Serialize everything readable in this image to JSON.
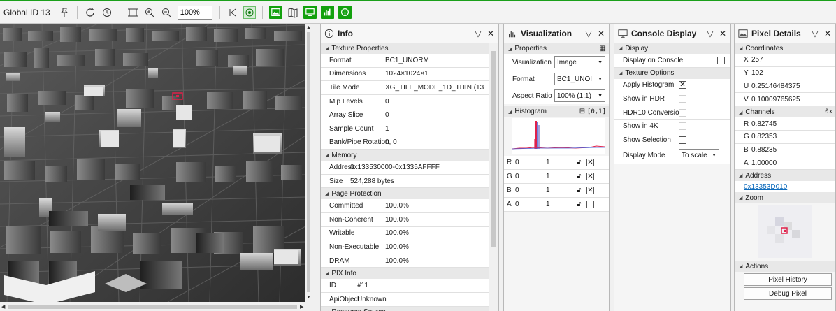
{
  "toolbar": {
    "title": "Global ID 13",
    "zoom_value": "100%",
    "icons": [
      "pin-icon",
      "refresh-icon",
      "history-icon",
      "fit-icon",
      "zoom-in-icon",
      "zoom-out-icon",
      "step-back-icon",
      "target-icon",
      "image-view-icon",
      "map-icon",
      "monitor-icon",
      "histogram-icon",
      "info-icon"
    ],
    "accent": "#13a10e"
  },
  "info": {
    "title": "Info",
    "sections": [
      {
        "title": "Texture Properties",
        "rows": [
          [
            "Format",
            "BC1_UNORM"
          ],
          [
            "Dimensions",
            "1024×1024×1"
          ],
          [
            "Tile Mode",
            "XG_TILE_MODE_1D_THIN (13"
          ],
          [
            "Mip Levels",
            "0"
          ],
          [
            "Array Slice",
            "0"
          ],
          [
            "Sample Count",
            "1"
          ],
          [
            "Bank/Pipe Rotation",
            "0, 0"
          ]
        ]
      },
      {
        "title": "Memory",
        "rows": [
          [
            "Address",
            "0x133530000-0x1335AFFFF"
          ],
          [
            "Size",
            "524,288 bytes"
          ]
        ]
      },
      {
        "title": "Page Protection",
        "rows": [
          [
            "Committed",
            "100.0%"
          ],
          [
            "Non-Coherent",
            "100.0%"
          ],
          [
            "Writable",
            "100.0%"
          ],
          [
            "Non-Executable",
            "100.0%"
          ],
          [
            "DRAM",
            "100.0%"
          ]
        ]
      },
      {
        "title": "PIX Info",
        "rows": [
          [
            "ID",
            "#11"
          ],
          [
            "ApiObject",
            "Unknown"
          ]
        ]
      },
      {
        "title": "Resource Source",
        "rows": []
      }
    ]
  },
  "viz": {
    "title": "Visualization",
    "properties_label": "Properties",
    "visualization_label": "Visualization",
    "visualization_value": "Image",
    "format_label": "Format",
    "format_value": "BC1_UNOI",
    "aspect_label": "Aspect Ratio",
    "aspect_value": "100% (1:1)",
    "histogram_label": "Histogram",
    "histogram_range": "[0,1]",
    "channels": [
      {
        "name": "R",
        "min": "0",
        "max": "1",
        "checked": "✕"
      },
      {
        "name": "G",
        "min": "0",
        "max": "1",
        "checked": "✕"
      },
      {
        "name": "B",
        "min": "0",
        "max": "1",
        "checked": "✕"
      },
      {
        "name": "A",
        "min": "0",
        "max": "1",
        "checked": ""
      }
    ]
  },
  "console": {
    "title": "Console Display",
    "display_section": "Display",
    "display_on_console": "Display on Console",
    "texture_options": "Texture Options",
    "apply_histogram": "Apply Histogram",
    "apply_histogram_check": "✕",
    "show_in_hdr": "Show in HDR",
    "hdr10": "HDR10 Conversion",
    "show_4k": "Show in 4K",
    "show_selection": "Show Selection",
    "display_mode_label": "Display Mode",
    "display_mode_value": "To scale"
  },
  "pixel": {
    "title": "Pixel Details",
    "coords_section": "Coordinates",
    "coords": [
      [
        "X",
        "257"
      ],
      [
        "Y",
        "102"
      ],
      [
        "U",
        "0.25146484375"
      ],
      [
        "V",
        "0.10009765625"
      ]
    ],
    "channels_section": "Channels",
    "channels_extra": "0x",
    "channels": [
      [
        "R",
        "0.82745"
      ],
      [
        "G",
        "0.82353"
      ],
      [
        "B",
        "0.88235"
      ],
      [
        "A",
        "1.00000"
      ]
    ],
    "address_section": "Address",
    "address_link": "0x13353D010",
    "zoom_section": "Zoom",
    "actions_section": "Actions",
    "pixel_history": "Pixel History",
    "debug_pixel": "Debug Pixel"
  }
}
